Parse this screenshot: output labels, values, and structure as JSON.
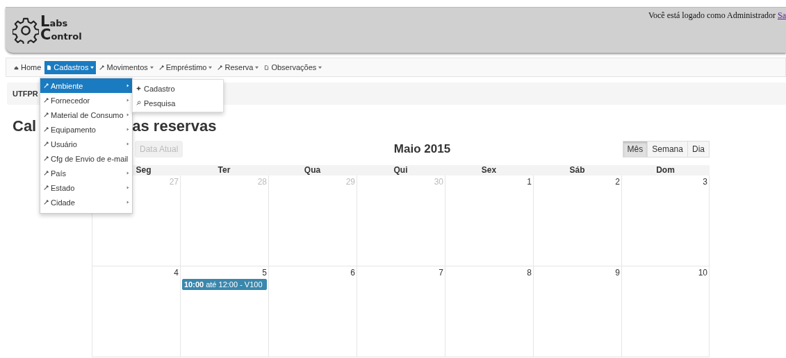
{
  "header": {
    "logo": {
      "line_1": "Labs",
      "line_2": "Control"
    },
    "login_text": "Você está logado como Administrador",
    "logout_link": "Sa"
  },
  "navbar": {
    "items": [
      {
        "label": "Home",
        "kind": "home",
        "dropdown": false,
        "selected": false
      },
      {
        "label": "Cadastros",
        "kind": "file",
        "dropdown": true,
        "selected": true
      },
      {
        "label": "Movimentos",
        "kind": "wrench",
        "dropdown": true,
        "selected": false
      },
      {
        "label": "Empréstimo",
        "kind": "wrench",
        "dropdown": true,
        "selected": false
      },
      {
        "label": "Reserva",
        "kind": "wrench",
        "dropdown": true,
        "selected": false
      },
      {
        "label": "Observações",
        "kind": "file",
        "dropdown": true,
        "selected": false
      }
    ]
  },
  "dropdown_menu": {
    "items": [
      {
        "label": "Ambiente",
        "selected": true
      },
      {
        "label": "Fornecedor",
        "selected": false
      },
      {
        "label": "Material de Consumo",
        "selected": false
      },
      {
        "label": "Equipamento",
        "selected": false
      },
      {
        "label": "Usuário",
        "selected": false
      },
      {
        "label": "Cfg de Envio de e-mail",
        "selected": false
      },
      {
        "label": "País",
        "selected": false
      },
      {
        "label": "Estado",
        "selected": false
      },
      {
        "label": "Cidade",
        "selected": false
      }
    ],
    "submenu": [
      {
        "label": "Cadastro",
        "kind": "plus"
      },
      {
        "label": "Pesquisa",
        "kind": "search"
      }
    ]
  },
  "breadcrumb": "UTFPR",
  "heading": {
    "part_1": "Cal",
    "part_2": "as reservas"
  },
  "calendar": {
    "today_button": {
      "label": "Data Atual",
      "disabled": true
    },
    "title": "Maio 2015",
    "views": [
      {
        "label": "Mês",
        "selected": true
      },
      {
        "label": "Semana",
        "selected": false
      },
      {
        "label": "Dia",
        "selected": false
      }
    ],
    "weekdays": [
      "Seg",
      "Ter",
      "Qua",
      "Qui",
      "Sex",
      "Sáb",
      "Dom"
    ],
    "weeks": [
      {
        "days": [
          {
            "number": "27",
            "other_month": true
          },
          {
            "number": "28",
            "other_month": true
          },
          {
            "number": "29",
            "other_month": true
          },
          {
            "number": "30",
            "other_month": true
          },
          {
            "number": "1",
            "other_month": false
          },
          {
            "number": "2",
            "other_month": false
          },
          {
            "number": "3",
            "other_month": false
          }
        ]
      },
      {
        "days": [
          {
            "number": "4",
            "other_month": false
          },
          {
            "number": "5",
            "other_month": false,
            "events": [
              {
                "text": "**10:00** até 12:00 - V100",
                "color": "#3a87ad"
              }
            ]
          },
          {
            "number": "6",
            "other_month": false
          },
          {
            "number": "7",
            "other_month": false
          },
          {
            "number": "8",
            "other_month": false
          },
          {
            "number": "9",
            "other_month": false
          },
          {
            "number": "10",
            "other_month": false
          }
        ]
      }
    ]
  }
}
